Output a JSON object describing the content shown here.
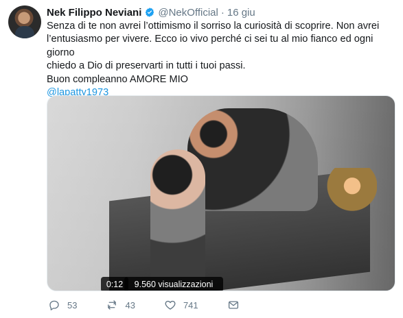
{
  "profile": {
    "avatar_icon": "avatar-photo",
    "name": "Nek Filippo Neviani",
    "handle": "@NekOfficial",
    "date": "16 giu",
    "verified_icon": "verified-badge-icon"
  },
  "tweet": {
    "lines": [
      "Senza di te non avrei l’ottimismo il sorriso la curiosità di scoprire. Non avrei",
      "l’entusiasmo per vivere. Ecco io vivo perché ci sei tu al mio fianco ed ogni giorno",
      "chiedo a Dio di preservarti in tutti i tuoi passi.",
      "Buon compleanno AMORE MIO"
    ],
    "mention": "@lapatty1973"
  },
  "media": {
    "duration": "0:12",
    "views": "9.560 visualizzazioni"
  },
  "actions": {
    "reply": {
      "icon": "reply-icon",
      "count": "53"
    },
    "retweet": {
      "icon": "retweet-icon",
      "count": "43"
    },
    "like": {
      "icon": "like-icon",
      "count": "741"
    },
    "dm": {
      "icon": "dm-icon"
    }
  },
  "colors": {
    "accent": "#1b95e0",
    "text": "#14171a",
    "muted": "#657786",
    "verified": "#1da1f2"
  }
}
